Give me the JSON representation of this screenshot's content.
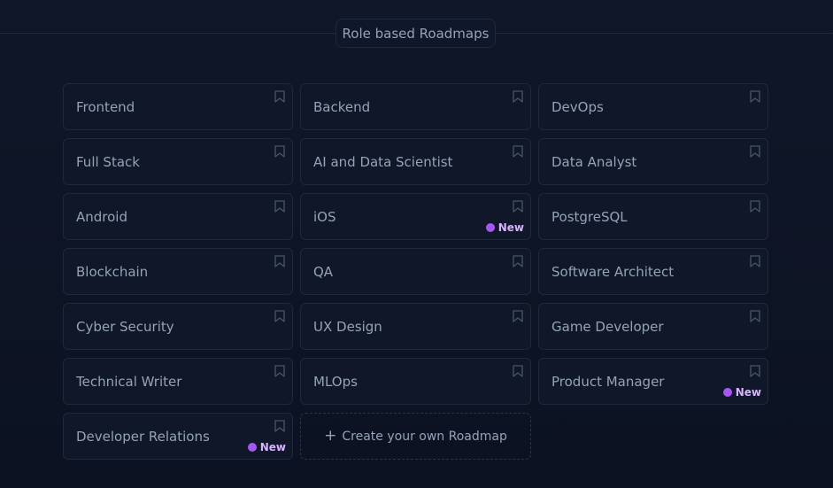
{
  "section": {
    "title": "Role based Roadmaps"
  },
  "roadmaps": [
    {
      "label": "Frontend",
      "badge": ""
    },
    {
      "label": "Backend",
      "badge": ""
    },
    {
      "label": "DevOps",
      "badge": ""
    },
    {
      "label": "Full Stack",
      "badge": ""
    },
    {
      "label": "AI and Data Scientist",
      "badge": ""
    },
    {
      "label": "Data Analyst",
      "badge": ""
    },
    {
      "label": "Android",
      "badge": ""
    },
    {
      "label": "iOS",
      "badge": "New"
    },
    {
      "label": "PostgreSQL",
      "badge": ""
    },
    {
      "label": "Blockchain",
      "badge": ""
    },
    {
      "label": "QA",
      "badge": ""
    },
    {
      "label": "Software Architect",
      "badge": ""
    },
    {
      "label": "Cyber Security",
      "badge": ""
    },
    {
      "label": "UX Design",
      "badge": ""
    },
    {
      "label": "Game Developer",
      "badge": ""
    },
    {
      "label": "Technical Writer",
      "badge": ""
    },
    {
      "label": "MLOps",
      "badge": ""
    },
    {
      "label": "Product Manager",
      "badge": "New"
    },
    {
      "label": "Developer Relations",
      "badge": "New"
    }
  ],
  "create": {
    "icon": "plus-icon",
    "label": "Create your own Roadmap"
  },
  "colors": {
    "badge_dot": "#a855f7",
    "badge_text": "#d8b4fe",
    "text": "#94a3b8",
    "border": "#1e293b"
  }
}
